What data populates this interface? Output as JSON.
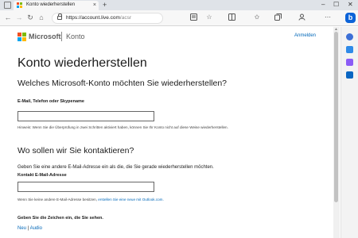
{
  "browser": {
    "tab_title": "Konto wiederherstellen",
    "tab_close": "×",
    "new_tab": "+",
    "url_host": "https://account.live.com",
    "url_path": "/acsr",
    "window_controls": [
      "–",
      "☐",
      "✕"
    ],
    "toolbar_icons": [
      "reader-view-icon",
      "favorites-star-icon",
      "split-screen-icon",
      "favorites-icon",
      "collections-icon",
      "profile-icon",
      "settings-more-icon"
    ],
    "bing_label": "b"
  },
  "sidebar": {
    "icons": [
      "search-icon",
      "shopping-icon",
      "tools-icon",
      "outlook-icon"
    ],
    "colors": [
      "#3c6fd6",
      "#2f8ae8",
      "#8b5cf6",
      "#0a66c2"
    ]
  },
  "header": {
    "brand": "Microsoft",
    "product": "Konto",
    "signin": "Anmelden",
    "logo_colors": [
      "#f25022",
      "#7fba00",
      "#00a4ef",
      "#ffb900"
    ]
  },
  "main": {
    "title": "Konto wiederherstellen",
    "section1_heading": "Welches Microsoft-Konto möchten Sie wiederherstellen?",
    "identity_label": "E-Mail, Telefon oder Skypename",
    "identity_value": "",
    "hint": "Hinweis: Wenn Sie die Überprüfung in zwei Schritten aktiviert haben, können Sie Ihr Konto nicht auf diese Weise wiederherstellen.",
    "section2_heading": "Wo sollen wir Sie kontaktieren?",
    "contact_intro": "Geben Sie eine andere E-Mail-Adresse ein als die, die Sie gerade wiederherstellen möchten.",
    "contact_label": "Kontakt E-Mail-Adresse",
    "contact_value": "",
    "contact_note_prefix": "Wenn Sie keine andere E-Mail-Adresse besitzen, ",
    "contact_note_link": "erstellen Sie eine neue mit Outlook.com.",
    "captcha_label": "Geben Sie die Zeichen ein, die Sie sehen.",
    "captcha_new": "Neu",
    "captcha_sep": "|",
    "captcha_audio": "Audio"
  }
}
